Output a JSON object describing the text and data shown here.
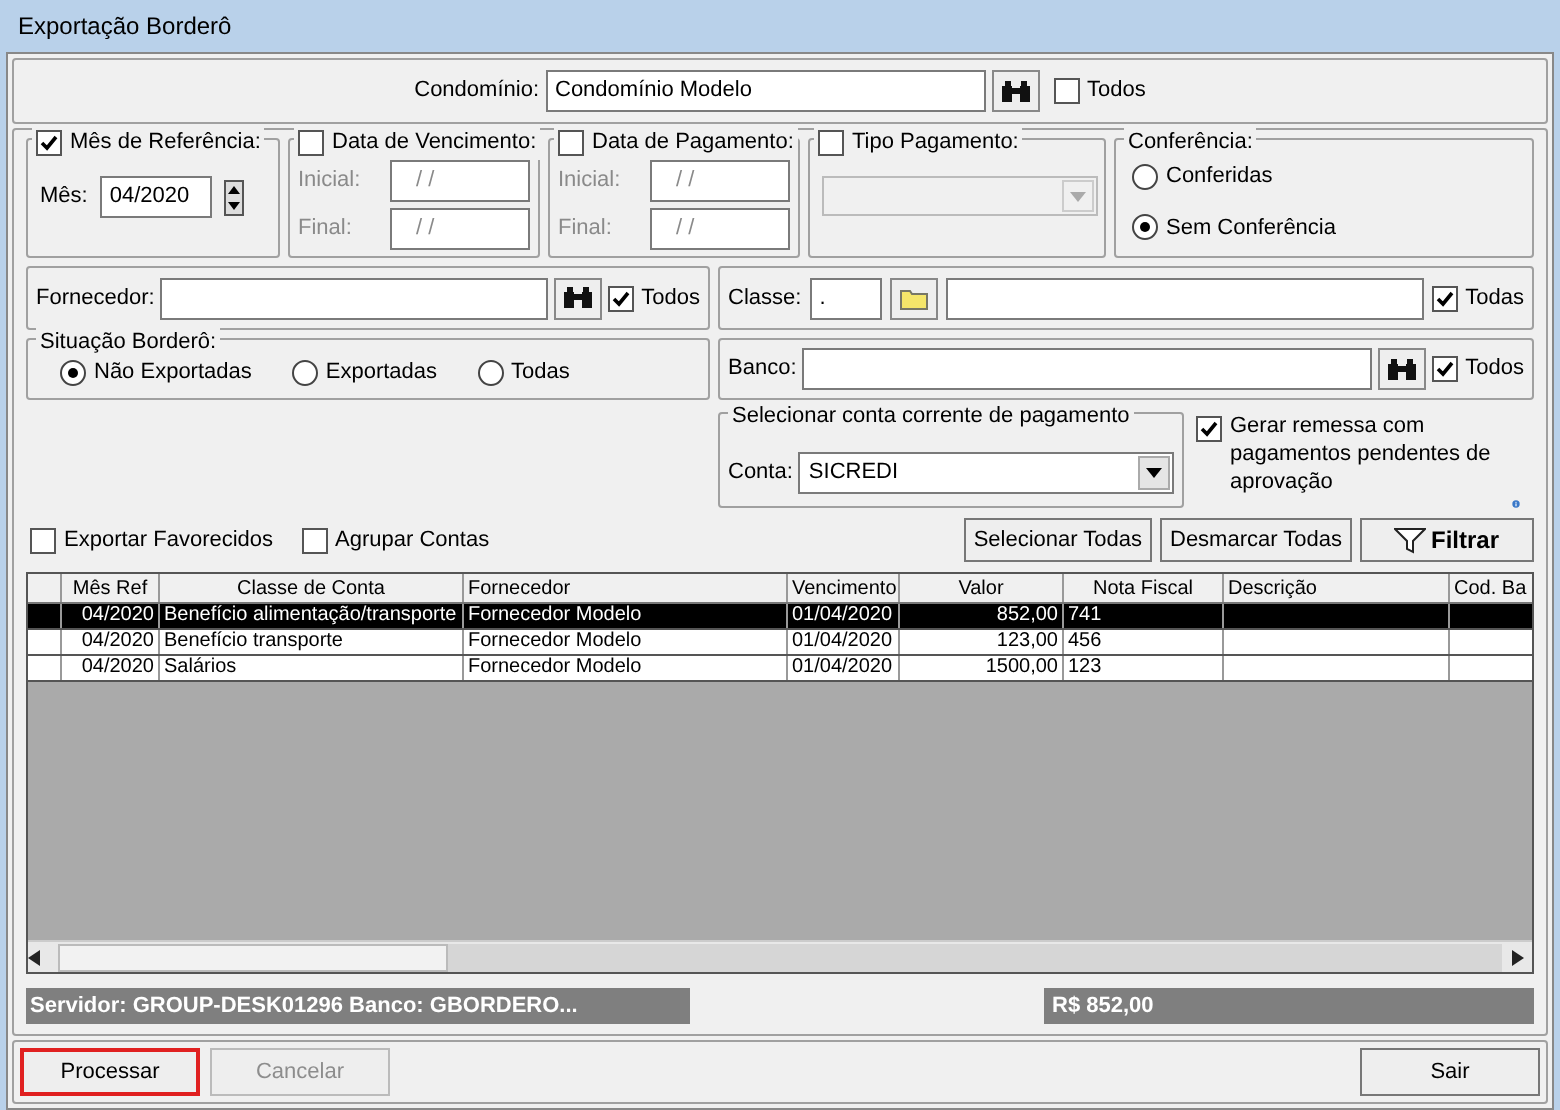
{
  "window": {
    "title": "Exportação Borderô"
  },
  "condominio": {
    "label": "Condomínio:",
    "value": "Condomínio Modelo",
    "todos": {
      "label": "Todos",
      "checked": false
    }
  },
  "mes_referencia": {
    "label": "Mês de Referência:",
    "checked": true,
    "mes_label": "Mês:",
    "value": "04/2020"
  },
  "date_groups": [
    {
      "label": "Data de Vencimento:",
      "checked": false,
      "fields": [
        {
          "label": "Inicial:",
          "value": "/ /"
        },
        {
          "label": "Final:",
          "value": "/ /"
        }
      ]
    },
    {
      "label": "Data de Pagamento:",
      "checked": false,
      "fields": [
        {
          "label": "Inicial:",
          "value": "/ /"
        },
        {
          "label": "Final:",
          "value": "/ /"
        }
      ]
    }
  ],
  "tipo_pagamento": {
    "label": "Tipo Pagamento:",
    "checked": false
  },
  "conferencia": {
    "label": "Conferência:",
    "options": [
      {
        "label": "Conferidas",
        "selected": false
      },
      {
        "label": "Sem Conferência",
        "selected": true
      }
    ]
  },
  "fornecedor": {
    "label": "Fornecedor:",
    "todos": {
      "label": "Todos",
      "checked": true
    }
  },
  "classe": {
    "label": "Classe:",
    "code": ".",
    "todas": {
      "label": "Todas",
      "checked": true
    }
  },
  "situacao": {
    "label": "Situação Borderô:",
    "options": [
      {
        "label": "Não Exportadas",
        "selected": true
      },
      {
        "label": "Exportadas",
        "selected": false
      },
      {
        "label": "Todas",
        "selected": false
      }
    ]
  },
  "banco": {
    "label": "Banco:",
    "todos": {
      "label": "Todos",
      "checked": true
    }
  },
  "conta_group": {
    "label": "Selecionar conta corrente de pagamento",
    "conta_label": "Conta:",
    "value": "SICREDI"
  },
  "gerar_remessa": {
    "label": "Gerar remessa com pagamentos pendentes de aprovação",
    "checked": true
  },
  "options": [
    {
      "label": "Exportar Favorecidos",
      "checked": false
    },
    {
      "label": "Agrupar Contas",
      "checked": false
    }
  ],
  "actions": [
    {
      "label": "Selecionar Todas",
      "kind": "plain"
    },
    {
      "label": "Desmarcar Todas",
      "kind": "plain"
    },
    {
      "label": "Filtrar",
      "kind": "filter"
    }
  ],
  "table": {
    "columns": [
      "Mês Ref",
      "Classe de Conta",
      "Fornecedor",
      "Vencimento",
      "Valor",
      "Nota Fiscal",
      "Descrição",
      "Cod. Ba"
    ],
    "rows": [
      {
        "selected": true,
        "cells": [
          "04/2020",
          "Benefício alimentação/transporte",
          "Fornecedor Modelo",
          "01/04/2020",
          "852,00",
          "741"
        ]
      },
      {
        "selected": false,
        "cells": [
          "04/2020",
          "Benefício transporte",
          "Fornecedor Modelo",
          "01/04/2020",
          "123,00",
          "456"
        ]
      },
      {
        "selected": false,
        "cells": [
          "04/2020",
          "Salários",
          "Fornecedor Modelo",
          "01/04/2020",
          "1500,00",
          "123"
        ]
      }
    ]
  },
  "status_bar": {
    "server": "Servidor: GROUP-DESK01296 Banco: GBORDERO...",
    "total": "R$ 852,00"
  },
  "buttons": [
    {
      "label": "Processar",
      "disabled": false,
      "highlighted": true
    },
    {
      "label": "Cancelar",
      "disabled": true,
      "highlighted": false
    },
    {
      "label": "Sair",
      "disabled": false,
      "highlighted": false
    }
  ]
}
